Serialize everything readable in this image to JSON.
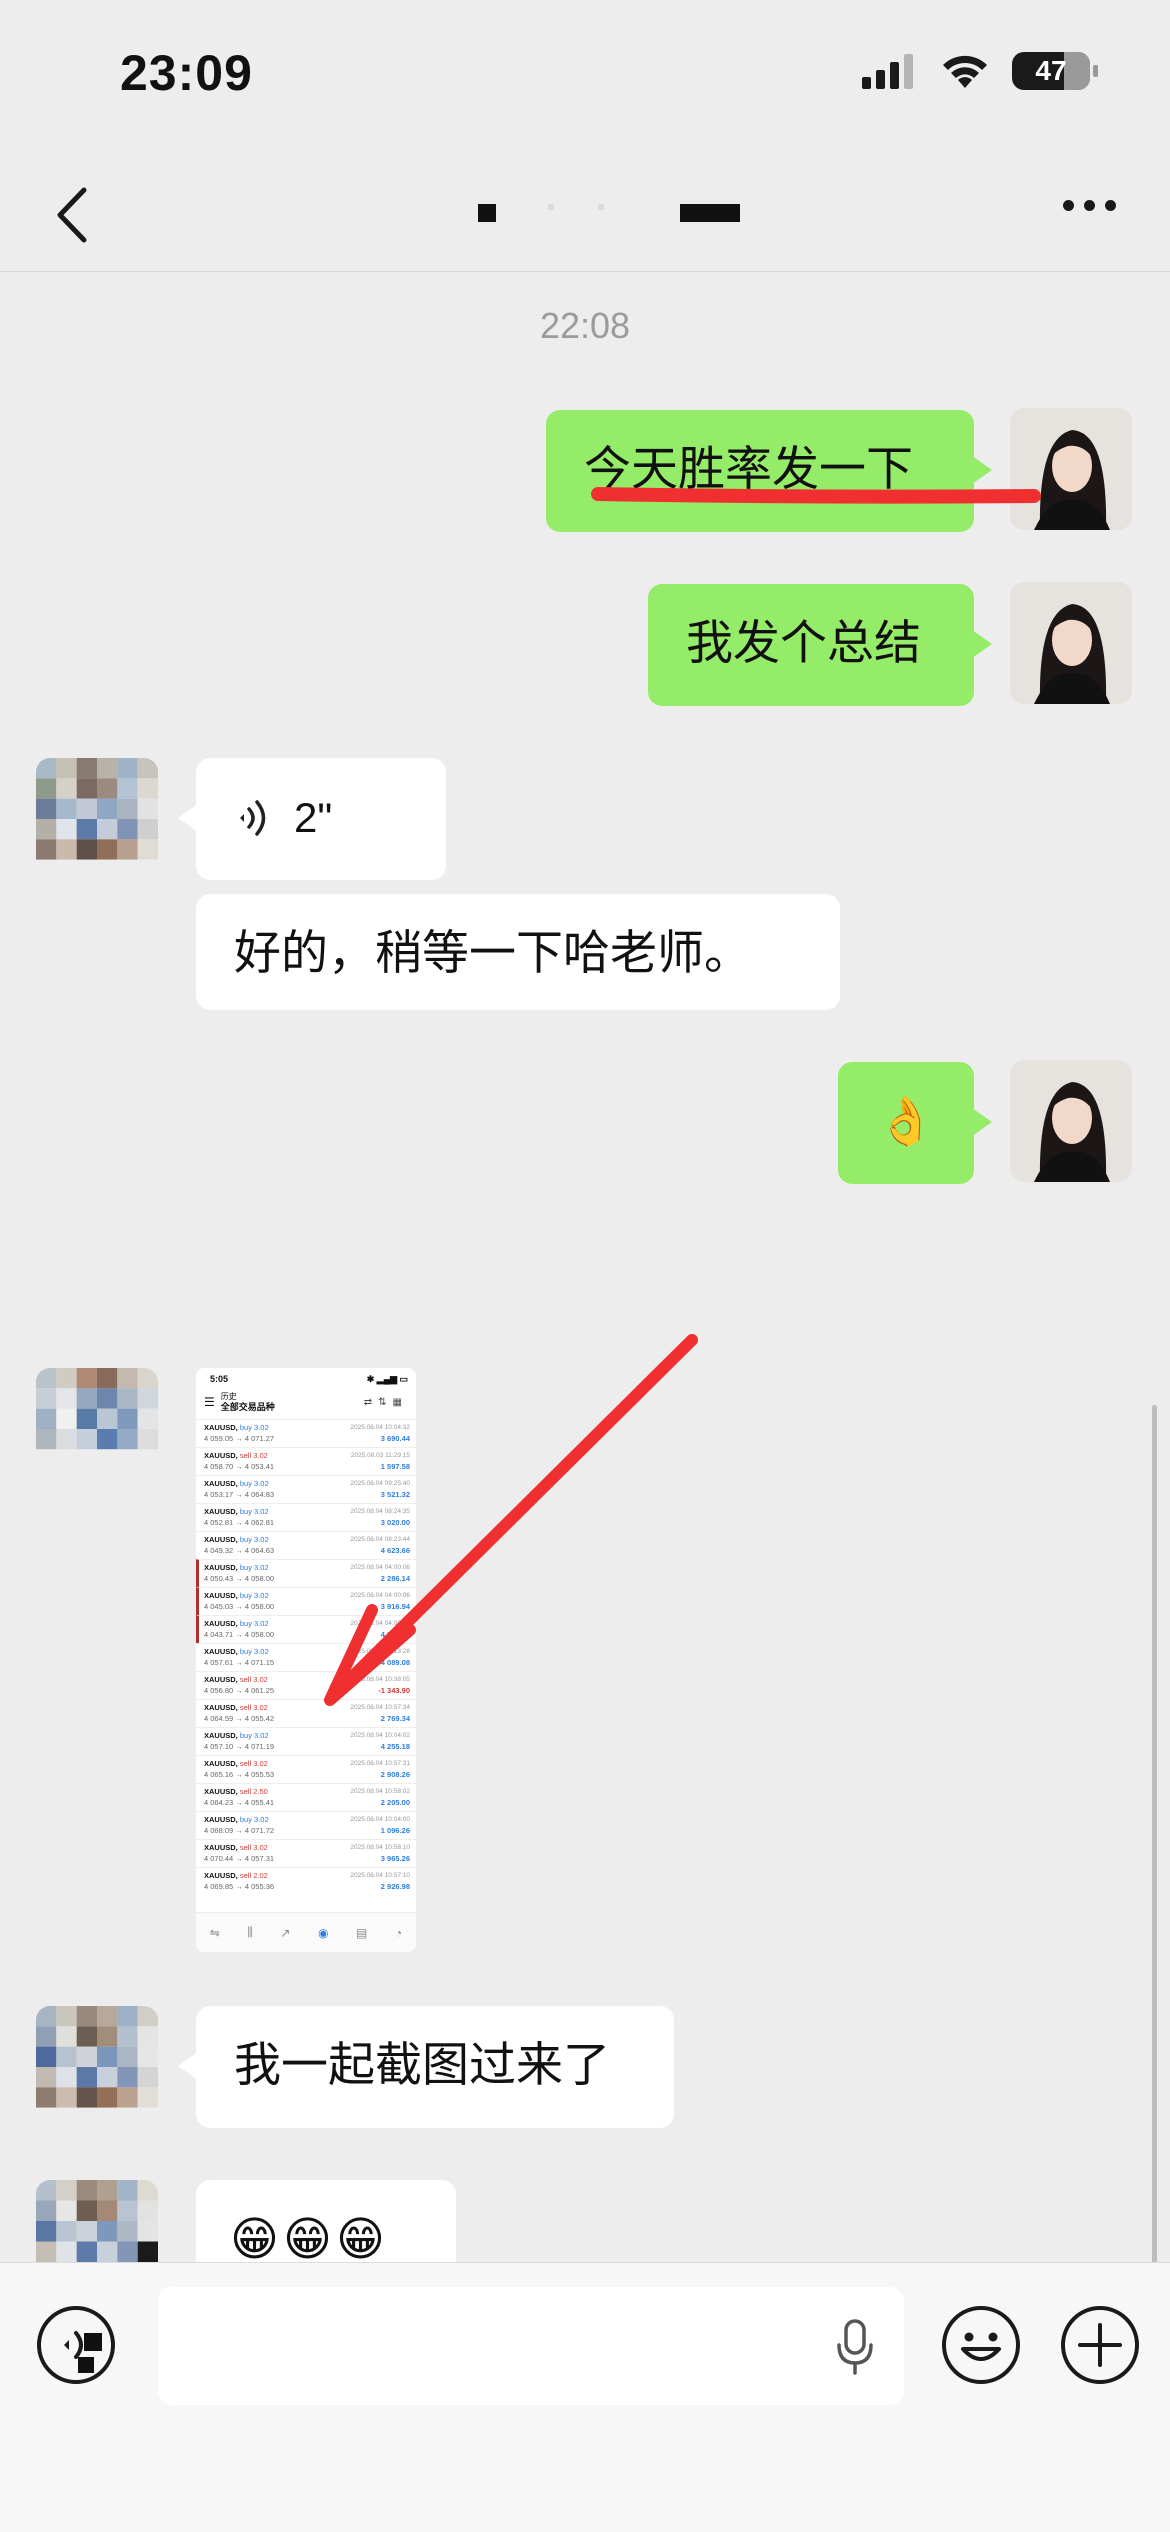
{
  "status_bar": {
    "time": "23:09",
    "battery": "47",
    "icons": [
      "signal-icon",
      "wifi-icon",
      "battery-icon"
    ]
  },
  "nav": {
    "back_icon": "chevron-left-icon",
    "more_icon": "more-dots-icon"
  },
  "chat": {
    "timestamp": "22:08",
    "messages": {
      "m1": "今天胜率发一下",
      "m2": "我发个总结",
      "m3_voice_duration": "2\"",
      "m4": "好的，稍等一下哈老师。",
      "m5": "👌",
      "m7": "我一起截图过来了",
      "m8": "😁😁😁"
    },
    "screenshot": {
      "time": "5:05",
      "header_small": "历史",
      "header_title": "全部交易品种",
      "rows": [
        {
          "symbol": "XAUUSD,",
          "side": "buy 3.02",
          "prices": "4 059.05 → 4 071.27",
          "date": "2025.08.04 10:04:32",
          "profit": "3 690.44"
        },
        {
          "symbol": "XAUUSD,",
          "side": "sell 3.02",
          "prices": "4 058.70 → 4 053.41",
          "date": "2025.08.03 11:29:15",
          "profit": "1 597.58"
        },
        {
          "symbol": "XAUUSD,",
          "side": "buy 3.02",
          "prices": "4 053.17 → 4 064.83",
          "date": "2025.08.04 09:25:40",
          "profit": "3 521.32"
        },
        {
          "symbol": "XAUUSD,",
          "side": "buy 3.02",
          "prices": "4 052.81 → 4 062.81",
          "date": "2025.08.04 08:24:35",
          "profit": "3 020.00"
        },
        {
          "symbol": "XAUUSD,",
          "side": "buy 3.02",
          "prices": "4 049.32 → 4 064.63",
          "date": "2025.08.04 08:23:44",
          "profit": "4 623.66"
        },
        {
          "symbol": "XAUUSD,",
          "side": "buy 3.02",
          "prices": "4 050.43 → 4 058.00",
          "date": "2025.08.04 04:00:06",
          "profit": "2 286.14"
        },
        {
          "symbol": "XAUUSD,",
          "side": "buy 3.02",
          "prices": "4 045.03 → 4 058.00",
          "date": "2025.08.04 04:00:06",
          "profit": "3 916.94"
        },
        {
          "symbol": "XAUUSD,",
          "side": "buy 3.02",
          "prices": "4 043.71 → 4 058.00",
          "date": "2025.08.04 04:00:06",
          "profit": "4 315.58"
        },
        {
          "symbol": "XAUUSD,",
          "side": "buy 3.02",
          "prices": "4 057.61 → 4 071.15",
          "date": "2025.08.04 10:13:28",
          "profit": "4 089.08"
        },
        {
          "symbol": "XAUUSD,",
          "side": "sell 3.02",
          "prices": "4 056.80 → 4 061.25",
          "date": "2025.08.04 10:38:05",
          "profit": "-1 343.90"
        },
        {
          "symbol": "XAUUSD,",
          "side": "sell 3.02",
          "prices": "4 064.59 → 4 055.42",
          "date": "2025.08.04 10:57:34",
          "profit": "2 769.34"
        },
        {
          "symbol": "XAUUSD,",
          "side": "buy 3.02",
          "prices": "4 057.10 → 4 071.19",
          "date": "2025.08.04 10:04:02",
          "profit": "4 255.18"
        },
        {
          "symbol": "XAUUSD,",
          "side": "sell 3.02",
          "prices": "4 065.16 → 4 055.53",
          "date": "2025.08.04 10:57:31",
          "profit": "2 908.26"
        },
        {
          "symbol": "XAUUSD,",
          "side": "sell 2.50",
          "prices": "4 064.23 → 4 055.41",
          "date": "2025.08.04 10:58:02",
          "profit": "2 205.00"
        },
        {
          "symbol": "XAUUSD,",
          "side": "buy 3.02",
          "prices": "4 068.09 → 4 071.72",
          "date": "2025.08.04 10:04:00",
          "profit": "1 096.26"
        },
        {
          "symbol": "XAUUSD,",
          "side": "sell 3.02",
          "prices": "4 070.44 → 4 057.31",
          "date": "2025.08.04 10:58:10",
          "profit": "3 965.26"
        },
        {
          "symbol": "XAUUSD,",
          "side": "sell 2.02",
          "prices": "4 069.85 → 4 055.36",
          "date": "2025.08.04 10:57:10",
          "profit": "2 926.98"
        }
      ]
    }
  },
  "input_bar": {
    "mode_icon": "voice-mode-icon",
    "mic_icon": "microphone-icon",
    "emoji_icon": "emoji-icon",
    "plus_icon": "plus-circle-icon"
  },
  "colors": {
    "outgoing_bubble": "#95ec69",
    "incoming_bubble": "#ffffff",
    "background": "#ededed",
    "annotation": "#f03030"
  }
}
